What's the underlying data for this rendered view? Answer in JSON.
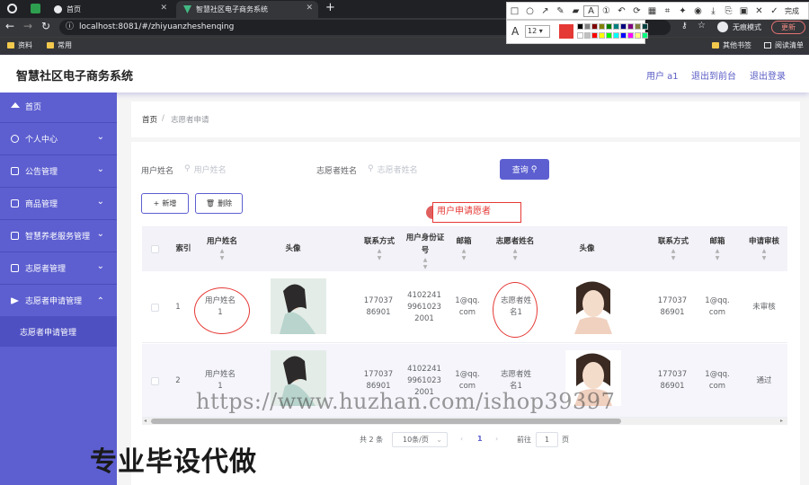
{
  "browser": {
    "tabs": [
      {
        "title": ""
      },
      {
        "title": "首页"
      },
      {
        "title": "智慧社区电子商务系统"
      }
    ],
    "new_tab": "+",
    "url": "localhost:8081/#/zhiyuanzheshenqing",
    "incognito_label": "无痕模式",
    "update_label": "更新",
    "bookmarks": [
      "资料",
      "常用"
    ],
    "bookmarks_right": [
      "其他书签",
      "阅读清单"
    ]
  },
  "annotation_toolbar": {
    "done_label": "完成",
    "font_label": "A",
    "font_size": "12",
    "current_color": "#e53935",
    "palette": [
      "#000000",
      "#808080",
      "#800000",
      "#808000",
      "#008000",
      "#008080",
      "#000080",
      "#800080",
      "#808040",
      "#004040",
      "#ffffff",
      "#c0c0c0",
      "#ff0000",
      "#ffff00",
      "#00ff00",
      "#00ffff",
      "#0000ff",
      "#ff00ff",
      "#ffff80",
      "#00ff80"
    ]
  },
  "app": {
    "title": "智慧社区电子商务系统",
    "user_label": "用户 a1",
    "back_label": "退出到前台",
    "logout_label": "退出登录"
  },
  "sidebar": {
    "items": [
      {
        "label": "首页",
        "has_arrow": false
      },
      {
        "label": "个人中心",
        "has_arrow": true
      },
      {
        "label": "公告管理",
        "has_arrow": true
      },
      {
        "label": "商品管理",
        "has_arrow": true
      },
      {
        "label": "智慧养老服务管理",
        "has_arrow": true
      },
      {
        "label": "志愿者管理",
        "has_arrow": true
      },
      {
        "label": "志愿者申请管理",
        "has_arrow": true
      }
    ],
    "submenu": "志愿者申请管理"
  },
  "breadcrumb": {
    "home": "首页",
    "sep": "/",
    "current": "志愿者申请"
  },
  "search": {
    "user_name_label": "用户姓名",
    "user_name_placeholder": "用户姓名",
    "volunteer_name_label": "志愿者姓名",
    "volunteer_name_placeholder": "志愿者姓名",
    "query_label": "查询"
  },
  "actions": {
    "add_label": "新增",
    "delete_label": "删除"
  },
  "annotation_text": "用户申请愿者",
  "table": {
    "headers": [
      "索引",
      "用户姓名",
      "头像",
      "联系方式",
      "用户身份证号",
      "邮箱",
      "志愿者姓名",
      "头像",
      "联系方式",
      "邮箱",
      "申请审核"
    ],
    "rows": [
      {
        "index": "1",
        "user_name": "用户姓名1",
        "phone": "17703786901",
        "id_card": "410224199610232001",
        "email": "1@qq.com",
        "vol_name": "志愿者姓名1",
        "vol_phone": "17703786901",
        "vol_email": "1@qq.com",
        "status": "未审核"
      },
      {
        "index": "2",
        "user_name": "用户姓名1",
        "phone": "17703786901",
        "id_card": "410224199610232001",
        "email": "1@qq.com",
        "vol_name": "志愿者姓名1",
        "vol_phone": "17703786901",
        "vol_email": "1@qq.com",
        "status": "通过"
      }
    ]
  },
  "pagination": {
    "total": "共 2 条",
    "page_size": "10条/页",
    "current_page": "1",
    "goto_label": "前往",
    "goto_value": "1",
    "page_suffix": "页"
  },
  "overlay": {
    "watermark": "https://www.huzhan.com/ishop39397",
    "promo": "专业毕设代做"
  },
  "colors": {
    "accent": "#5d5fd0",
    "annotation": "#e53935"
  }
}
